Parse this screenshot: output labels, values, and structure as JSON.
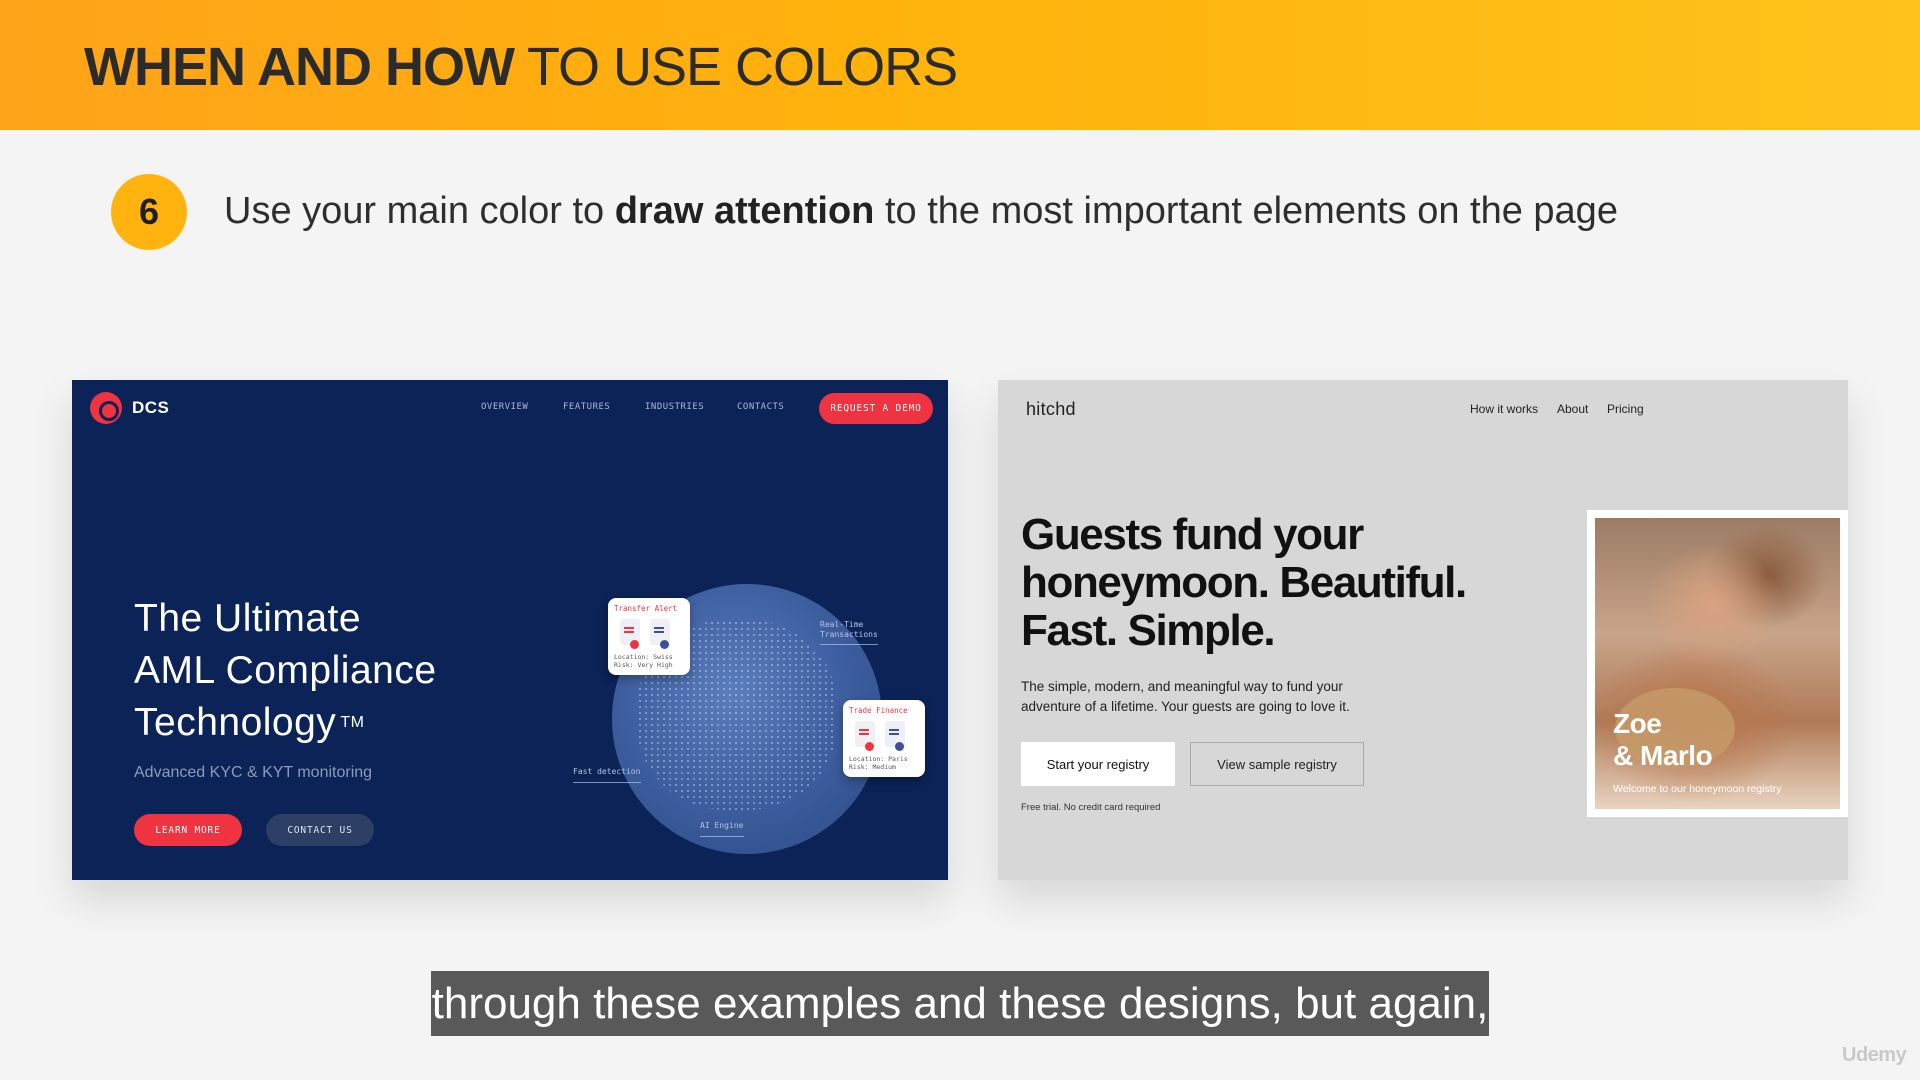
{
  "banner": {
    "title_strong": "WHEN AND HOW",
    "title_rest": " TO USE COLORS"
  },
  "tip": {
    "number": "6",
    "text_before": "Use your main color to ",
    "text_bold": "draw attention",
    "text_after": " to the most important elements on the page"
  },
  "dcs_card": {
    "logo_text": "DCS",
    "nav": [
      "OVERVIEW",
      "FEATURES",
      "INDUSTRIES",
      "CONTACTS"
    ],
    "cta": "REQUEST A DEMO",
    "headline_1": "The Ultimate",
    "headline_2": "AML Compliance",
    "headline_3": "Technology",
    "trademark": "TM",
    "subtitle": "Advanced KYC & KYT monitoring",
    "learn_more": "LEARN MORE",
    "contact_us": "CONTACT US",
    "tag_realtime": "Real-Time\nTransactions",
    "tag_fast": "Fast detection",
    "tag_ai": "AI Engine",
    "alert1": {
      "title": "Transfer Alert",
      "meta": "Location: Swiss\nRisk: Very High"
    },
    "alert2": {
      "title": "Trade Finance",
      "meta": "Location: Paris\nRisk: Medium"
    },
    "colors": {
      "background": "#0b2357",
      "accent": "#ef3340"
    }
  },
  "hitchd_card": {
    "logo": "hitchd",
    "nav": [
      "How it works",
      "About",
      "Pricing"
    ],
    "headline": "Guests fund your honeymoon. Beautiful. Fast. Simple.",
    "subtitle": "The simple, modern, and meaningful way to fund your adventure of a lifetime. Your guests are going to love it.",
    "start_registry": "Start your registry",
    "view_sample": "View sample registry",
    "free_trial": "Free trial. No credit card required",
    "photo_name_1": "Zoe",
    "photo_name_2": "& Marlo",
    "photo_welcome": "Welcome to our honeymoon registry",
    "colors": {
      "background": "#d7d7d7"
    }
  },
  "caption": "through these examples and these designs, but again,",
  "watermark": "Udemy"
}
